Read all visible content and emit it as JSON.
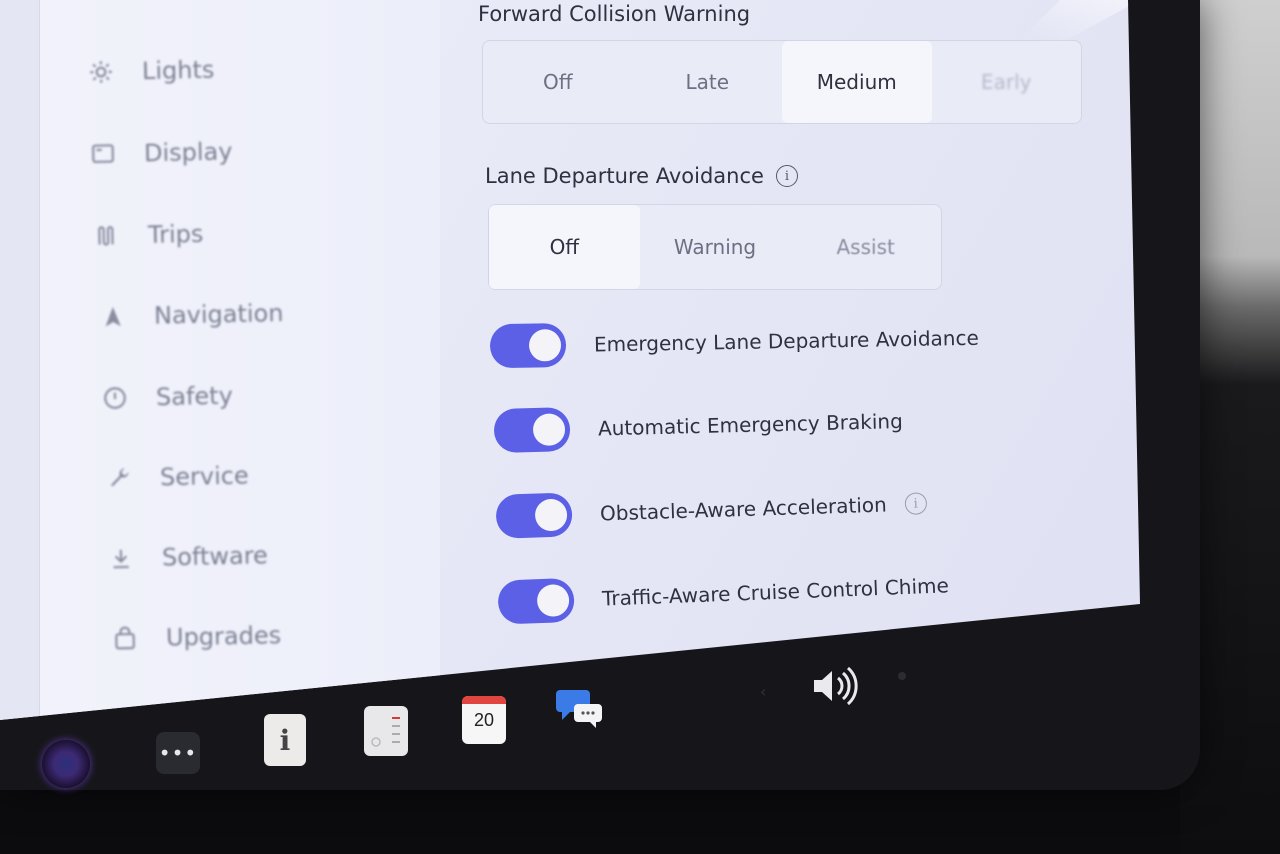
{
  "sidebar": {
    "items": [
      {
        "label": "Lights",
        "icon": "sun-icon"
      },
      {
        "label": "Display",
        "icon": "display-icon"
      },
      {
        "label": "Trips",
        "icon": "trips-icon"
      },
      {
        "label": "Navigation",
        "icon": "navigation-arrow-icon"
      },
      {
        "label": "Safety",
        "icon": "safety-icon"
      },
      {
        "label": "Service",
        "icon": "wrench-icon"
      },
      {
        "label": "Software",
        "icon": "download-icon"
      },
      {
        "label": "Upgrades",
        "icon": "shopping-bag-icon"
      }
    ]
  },
  "forward_collision_warning": {
    "label": "Forward Collision Warning",
    "options": [
      "Off",
      "Late",
      "Medium",
      "Early"
    ],
    "selected": "Medium"
  },
  "lane_departure_avoidance": {
    "label": "Lane Departure Avoidance",
    "options": [
      "Off",
      "Warning",
      "Assist"
    ],
    "selected": "Off"
  },
  "toggles": [
    {
      "label": "Emergency Lane Departure Avoidance",
      "on": true
    },
    {
      "label": "Automatic Emergency Braking",
      "on": true
    },
    {
      "label": "Obstacle-Aware Acceleration",
      "on": true,
      "info": true
    },
    {
      "label": "Traffic-Aware Cruise Control Chime",
      "on": true
    }
  ],
  "taskbar": {
    "calendar_day": "20",
    "manual_glyph": "i",
    "dots_glyph": "•••"
  },
  "colors": {
    "accent": "#5b60e6",
    "screen_bg": "#e6e8f6",
    "bezel": "#16161a"
  }
}
